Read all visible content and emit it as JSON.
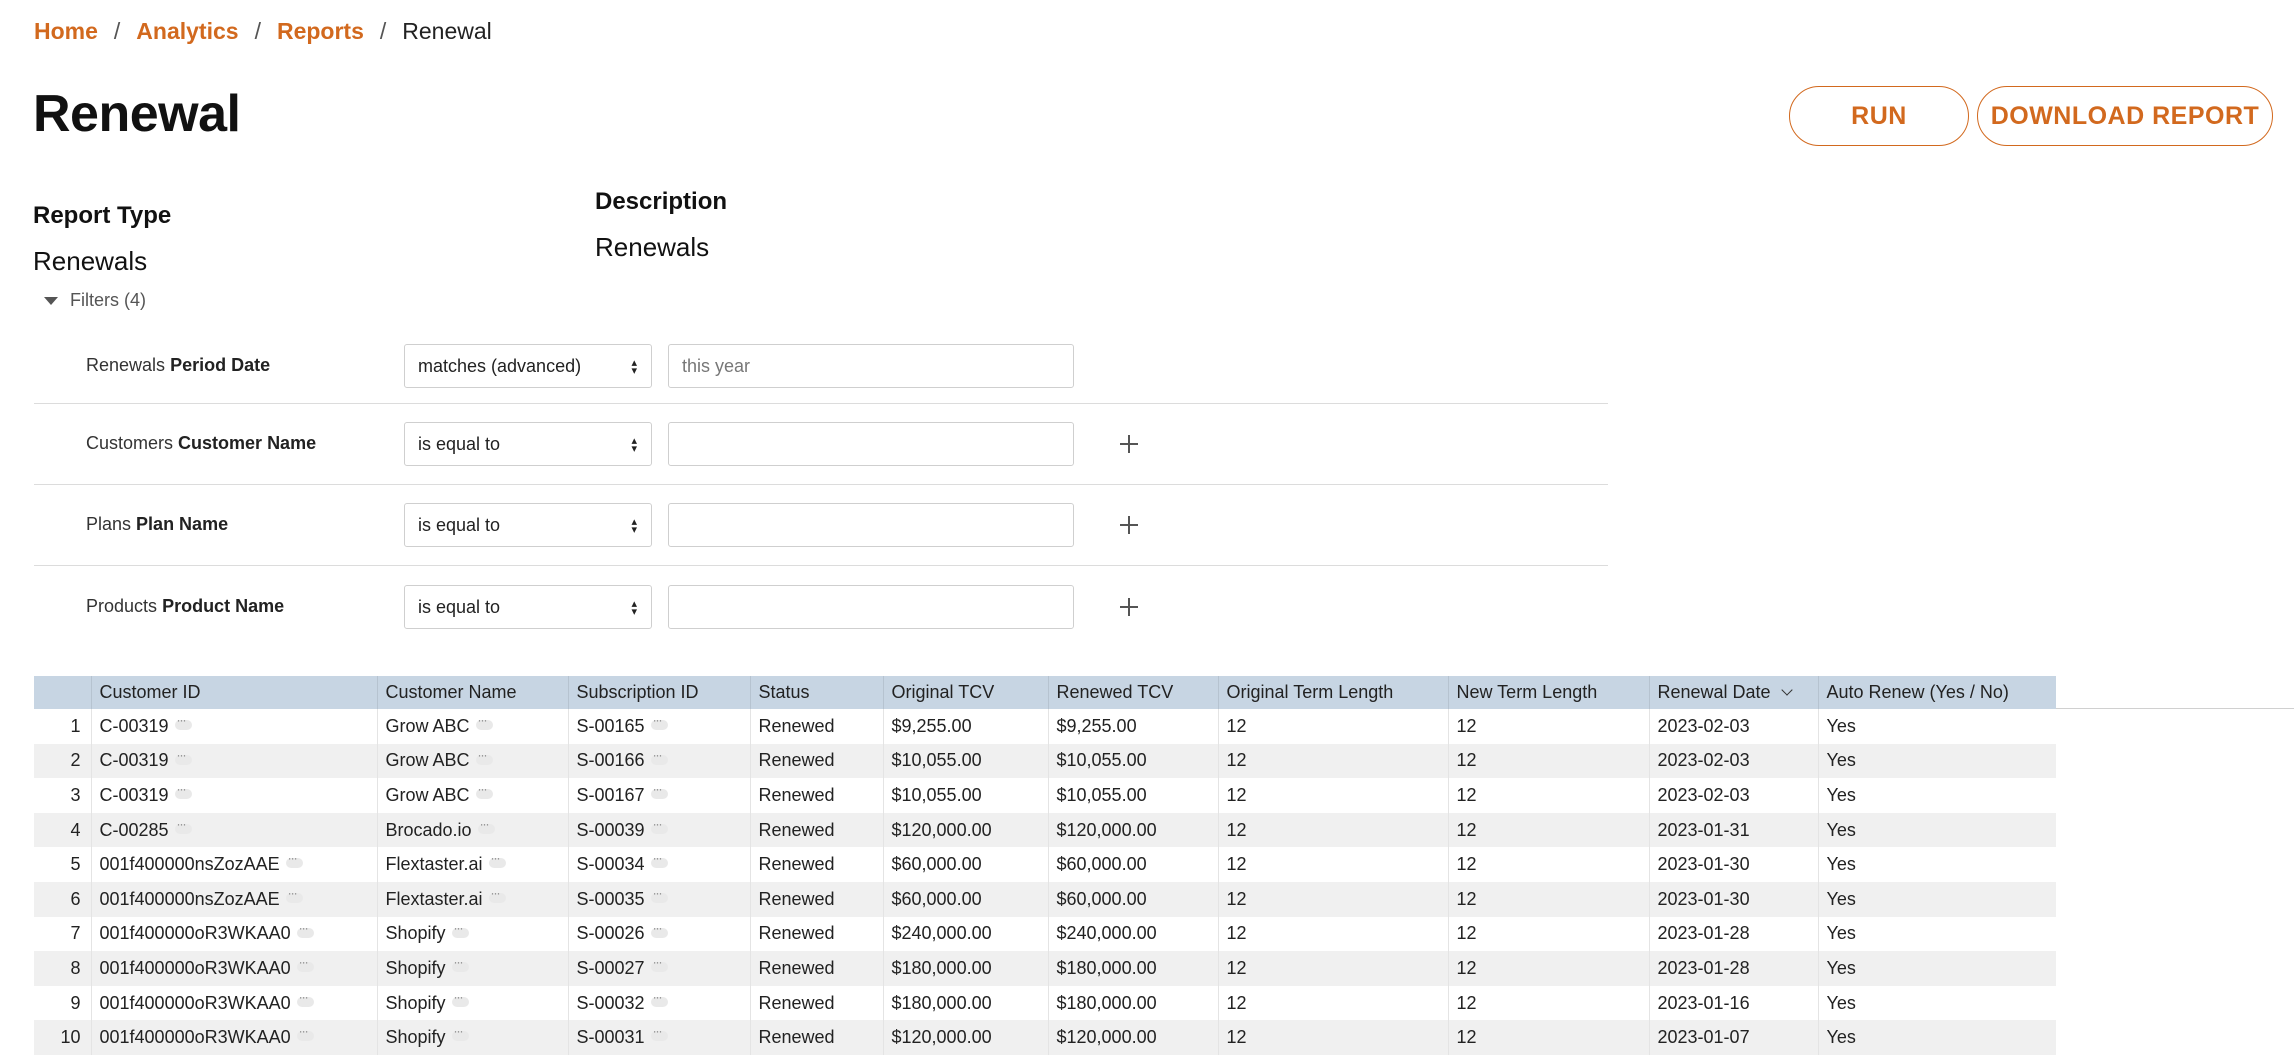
{
  "breadcrumb": {
    "home": "Home",
    "analytics": "Analytics",
    "reports": "Reports",
    "current": "Renewal",
    "separator": "/"
  },
  "page": {
    "title": "Renewal"
  },
  "actions": {
    "run_label": "RUN",
    "download_label": "DOWNLOAD REPORT"
  },
  "report_type": {
    "label": "Report Type",
    "value": "Renewals"
  },
  "description": {
    "label": "Description",
    "value": "Renewals"
  },
  "filters": {
    "toggle_label": "Filters (4)",
    "rows": [
      {
        "entity": "Renewals",
        "field": "Period Date",
        "operator": "matches (advanced)",
        "placeholder": "this year",
        "value": ""
      },
      {
        "entity": "Customers",
        "field": "Customer Name",
        "operator": "is equal to",
        "placeholder": "",
        "value": ""
      },
      {
        "entity": "Plans",
        "field": "Plan Name",
        "operator": "is equal to",
        "placeholder": "",
        "value": ""
      },
      {
        "entity": "Products",
        "field": "Product Name",
        "operator": "is equal to",
        "placeholder": "",
        "value": ""
      }
    ]
  },
  "table": {
    "columns": [
      "Customer ID",
      "Customer Name",
      "Subscription ID",
      "Status",
      "Original TCV",
      "Renewed TCV",
      "Original Term Length",
      "New Term Length",
      "Renewal Date",
      "Auto Renew (Yes / No)"
    ],
    "sorted_column": "Renewal Date",
    "rows": [
      [
        "1",
        "C-00319",
        "Grow ABC",
        "S-00165",
        "Renewed",
        "$9,255.00",
        "$9,255.00",
        "12",
        "12",
        "2023-02-03",
        "Yes"
      ],
      [
        "2",
        "C-00319",
        "Grow ABC",
        "S-00166",
        "Renewed",
        "$10,055.00",
        "$10,055.00",
        "12",
        "12",
        "2023-02-03",
        "Yes"
      ],
      [
        "3",
        "C-00319",
        "Grow ABC",
        "S-00167",
        "Renewed",
        "$10,055.00",
        "$10,055.00",
        "12",
        "12",
        "2023-02-03",
        "Yes"
      ],
      [
        "4",
        "C-00285",
        "Brocado.io",
        "S-00039",
        "Renewed",
        "$120,000.00",
        "$120,000.00",
        "12",
        "12",
        "2023-01-31",
        "Yes"
      ],
      [
        "5",
        "001f400000nsZozAAE",
        "Flextaster.ai",
        "S-00034",
        "Renewed",
        "$60,000.00",
        "$60,000.00",
        "12",
        "12",
        "2023-01-30",
        "Yes"
      ],
      [
        "6",
        "001f400000nsZozAAE",
        "Flextaster.ai",
        "S-00035",
        "Renewed",
        "$60,000.00",
        "$60,000.00",
        "12",
        "12",
        "2023-01-30",
        "Yes"
      ],
      [
        "7",
        "001f400000oR3WKAA0",
        "Shopify",
        "S-00026",
        "Renewed",
        "$240,000.00",
        "$240,000.00",
        "12",
        "12",
        "2023-01-28",
        "Yes"
      ],
      [
        "8",
        "001f400000oR3WKAA0",
        "Shopify",
        "S-00027",
        "Renewed",
        "$180,000.00",
        "$180,000.00",
        "12",
        "12",
        "2023-01-28",
        "Yes"
      ],
      [
        "9",
        "001f400000oR3WKAA0",
        "Shopify",
        "S-00032",
        "Renewed",
        "$180,000.00",
        "$180,000.00",
        "12",
        "12",
        "2023-01-16",
        "Yes"
      ],
      [
        "10",
        "001f400000oR3WKAA0",
        "Shopify",
        "S-00031",
        "Renewed",
        "$120,000.00",
        "$120,000.00",
        "12",
        "12",
        "2023-01-07",
        "Yes"
      ]
    ]
  },
  "colors": {
    "accent": "#d2691e",
    "table_header": "#c7d5e3",
    "row_alt": "#f0f0f0"
  }
}
